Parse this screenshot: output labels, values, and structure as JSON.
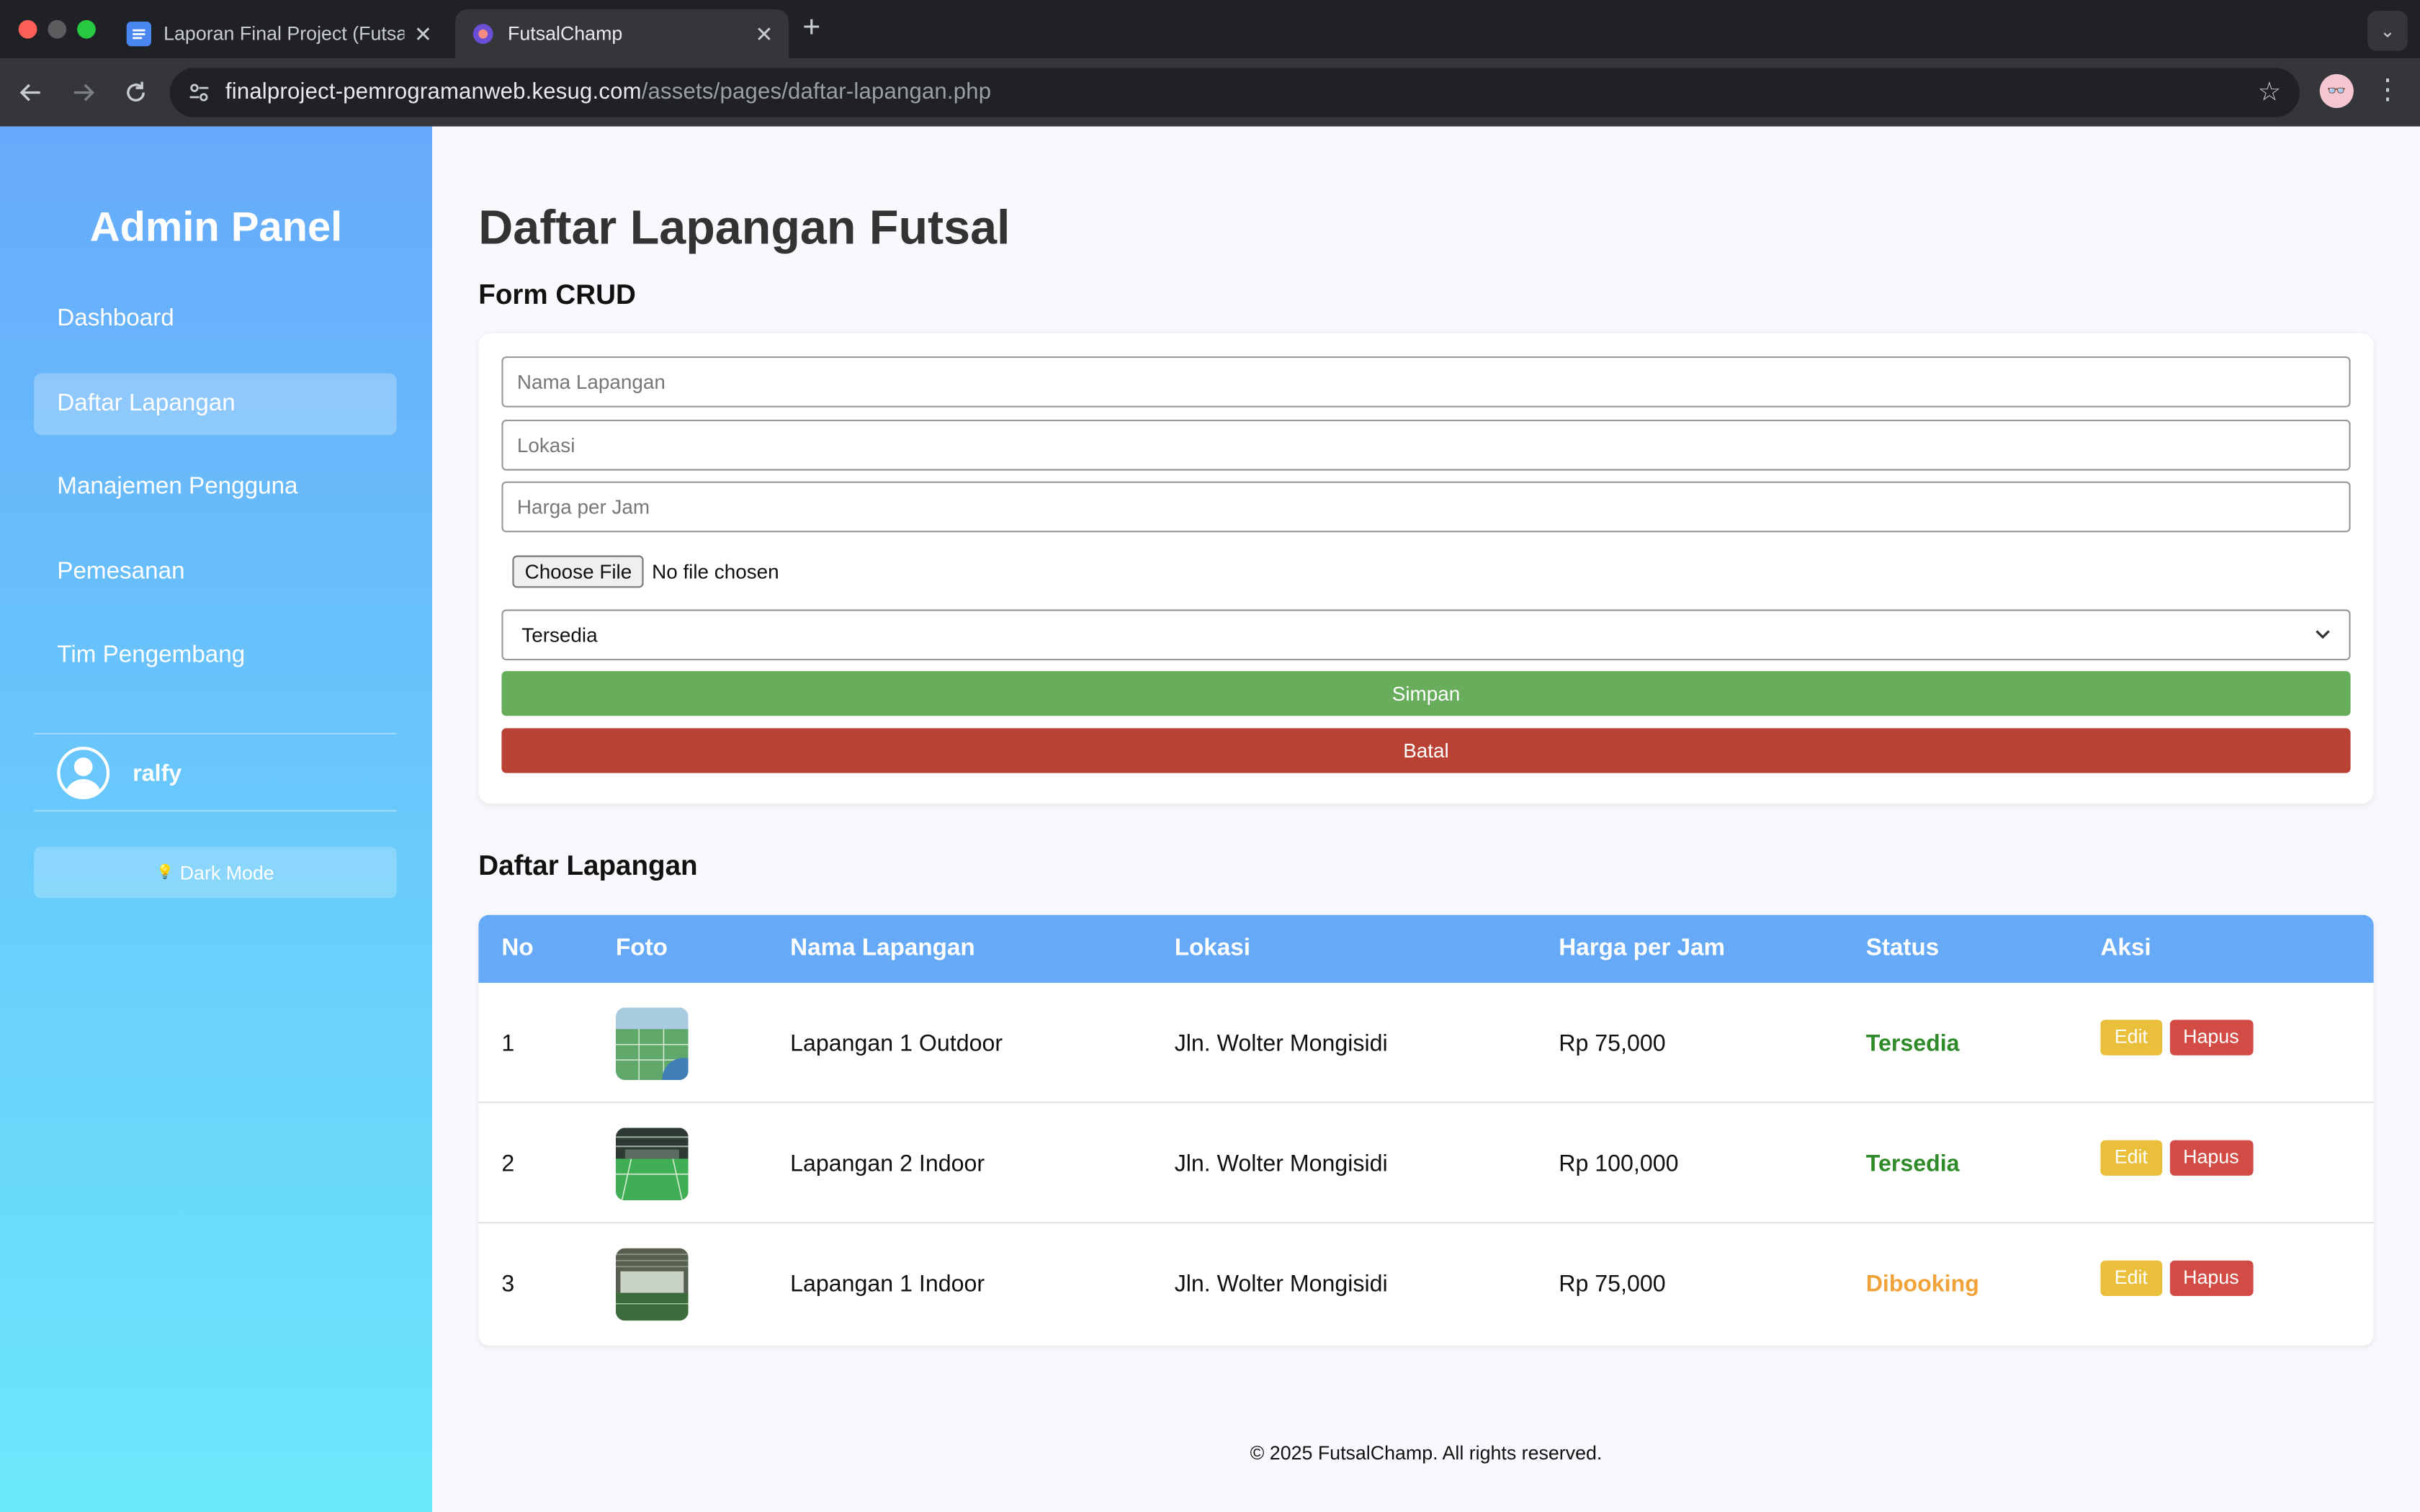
{
  "browser": {
    "tabs": [
      {
        "title": "Laporan Final Project (FutsalC",
        "active": false,
        "favicon": "google-docs-icon"
      },
      {
        "title": "FutsalChamp",
        "active": true,
        "favicon": "globe-icon"
      }
    ],
    "url_domain": "finalproject-pemrogramanweb.kesug.com",
    "url_path": "/assets/pages/daftar-lapangan.php"
  },
  "sidebar": {
    "title": "Admin Panel",
    "items": [
      {
        "label": "Dashboard",
        "active": false
      },
      {
        "label": "Daftar Lapangan",
        "active": true
      },
      {
        "label": "Manajemen Pengguna",
        "active": false
      },
      {
        "label": "Pemesanan",
        "active": false
      },
      {
        "label": "Tim Pengembang",
        "active": false
      }
    ],
    "username": "ralfy",
    "dark_mode_label": "Dark Mode"
  },
  "main": {
    "page_title": "Daftar Lapangan Futsal",
    "form_title": "Form CRUD",
    "form": {
      "nama_placeholder": "Nama Lapangan",
      "lokasi_placeholder": "Lokasi",
      "harga_placeholder": "Harga per Jam",
      "file_button": "Choose File",
      "file_status": "No file chosen",
      "status_selected": "Tersedia",
      "save_label": "Simpan",
      "cancel_label": "Batal"
    },
    "list_title": "Daftar Lapangan",
    "table": {
      "headers": [
        "No",
        "Foto",
        "Nama Lapangan",
        "Lokasi",
        "Harga per Jam",
        "Status",
        "Aksi"
      ],
      "rows": [
        {
          "no": "1",
          "nama": "Lapangan 1 Outdoor",
          "lokasi": "Jln. Wolter Mongisidi",
          "harga": "Rp 75,000",
          "status": "Tersedia"
        },
        {
          "no": "2",
          "nama": "Lapangan 2 Indoor",
          "lokasi": "Jln. Wolter Mongisidi",
          "harga": "Rp 100,000",
          "status": "Tersedia"
        },
        {
          "no": "3",
          "nama": "Lapangan 1 Indoor",
          "lokasi": "Jln. Wolter Mongisidi",
          "harga": "Rp 75,000",
          "status": "Dibooking"
        }
      ],
      "edit_label": "Edit",
      "delete_label": "Hapus"
    },
    "footer": "© 2025 FutsalChamp. All rights reserved."
  },
  "colors": {
    "header_blue": "#65a9f7",
    "save_green": "#68ad5c",
    "cancel_red": "#b94234",
    "status_available": "#2f8a2a",
    "status_booked": "#f0a33a",
    "edit_yellow": "#eabf3c",
    "delete_red": "#d24c45"
  }
}
